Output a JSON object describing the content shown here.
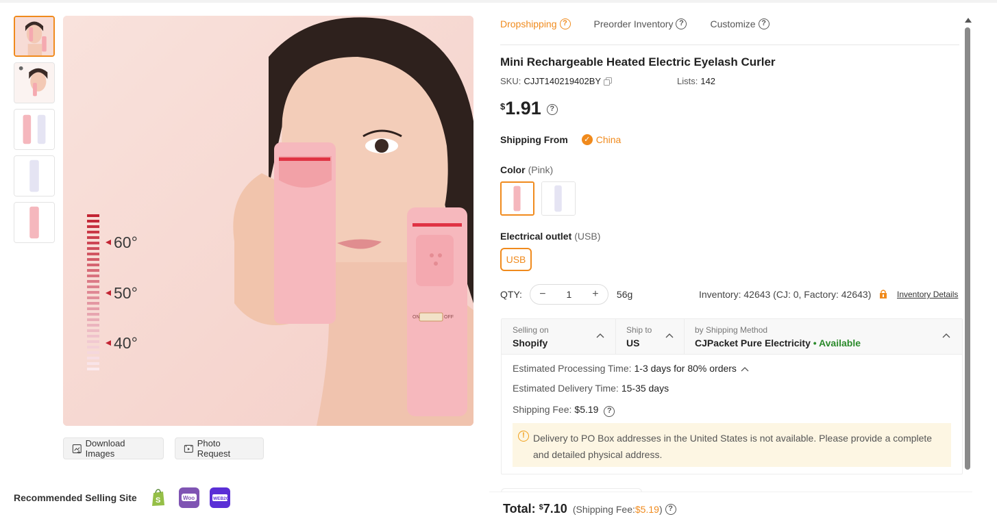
{
  "gallery": {
    "thumbnails": [
      "thumb-woman-curler",
      "thumb-woman-side",
      "thumb-pink-white-pair",
      "thumb-white-curler",
      "thumb-pink-curler"
    ],
    "active_index": 0,
    "main_image": {
      "temps": [
        "60°",
        "50°",
        "40°"
      ],
      "switch_on": "ON",
      "switch_off": "OFF"
    },
    "download_label": "Download Images",
    "photo_request_label": "Photo Request"
  },
  "recommended": {
    "label": "Recommended Selling Site",
    "sites": [
      "shopify-icon",
      "woocommerce-icon",
      "wix-b2c-icon"
    ]
  },
  "tabs": [
    {
      "label": "Dropshipping",
      "active": true
    },
    {
      "label": "Preorder Inventory",
      "active": false
    },
    {
      "label": "Customize",
      "active": false
    }
  ],
  "product": {
    "title": "Mini Rechargeable Heated Electric Eyelash Curler",
    "sku_label": "SKU:",
    "sku": "CJJT140219402BY",
    "lists_label": "Lists:",
    "lists": "142",
    "price_currency": "$",
    "price": "1.91"
  },
  "shipping_from": {
    "label": "Shipping From",
    "country": "China"
  },
  "color": {
    "label": "Color",
    "selected": "(Pink)",
    "options": [
      "pink",
      "white"
    ]
  },
  "outlet": {
    "label": "Electrical outlet",
    "selected": "(USB)",
    "option": "USB"
  },
  "quantity": {
    "label": "QTY:",
    "value": "1",
    "minus": "−",
    "plus": "+",
    "weight": "56g",
    "inventory": "Inventory: 42643  (CJ: 0, Factory: 42643)",
    "inventory_link": "Inventory Details"
  },
  "shipping": {
    "selling_on_label": "Selling on",
    "selling_on": "Shopify",
    "ship_to_label": "Ship to",
    "ship_to": "US",
    "method_label": "by Shipping Method",
    "method": "CJPacket Pure Electricity",
    "availability": "• Available",
    "processing_label": "Estimated Processing Time:",
    "processing": "1-3 days for 80% orders",
    "delivery_label": "Estimated Delivery Time:",
    "delivery": "15-35 days",
    "fee_label": "Shipping Fee:",
    "fee": "$5.19",
    "warning": "Delivery to PO Box addresses in the United States is not available. Please provide a complete and detailed physical address."
  },
  "total": {
    "label": "Total:",
    "currency": "$",
    "amount": "7.10",
    "fee_prefix": "(Shipping Fee: ",
    "fee": "$5.19",
    "fee_suffix": ")"
  },
  "colors": {
    "accent": "#f08a1c",
    "available": "#2a8a2a",
    "warning_bg": "#fdf6e3"
  }
}
